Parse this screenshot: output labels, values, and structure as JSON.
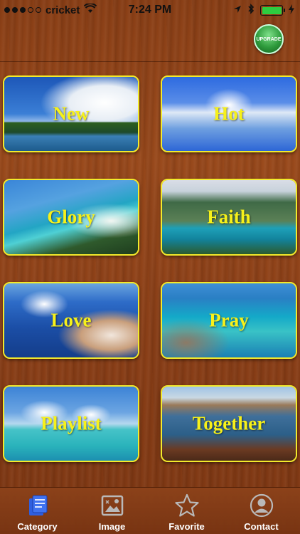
{
  "status": {
    "carrier": "cricket",
    "time": "7:24 PM"
  },
  "header": {
    "upgrade_label": "UPGRADE"
  },
  "tiles": [
    {
      "label": "New"
    },
    {
      "label": "Hot"
    },
    {
      "label": "Glory"
    },
    {
      "label": "Faith"
    },
    {
      "label": "Love"
    },
    {
      "label": "Pray"
    },
    {
      "label": "Playlist"
    },
    {
      "label": "Together"
    }
  ],
  "tabbar": {
    "tabs": [
      {
        "label": "Category",
        "icon": "category-icon",
        "active": true
      },
      {
        "label": "Image",
        "icon": "image-icon",
        "active": false
      },
      {
        "label": "Favorite",
        "icon": "star-icon",
        "active": false
      },
      {
        "label": "Contact",
        "icon": "contact-icon",
        "active": false
      }
    ]
  },
  "colors": {
    "tile_label": "#f7f11a",
    "tile_border": "#f3ea2b",
    "active_tab": "#2f5fe0",
    "inactive_tab": "#b9b9b9"
  }
}
